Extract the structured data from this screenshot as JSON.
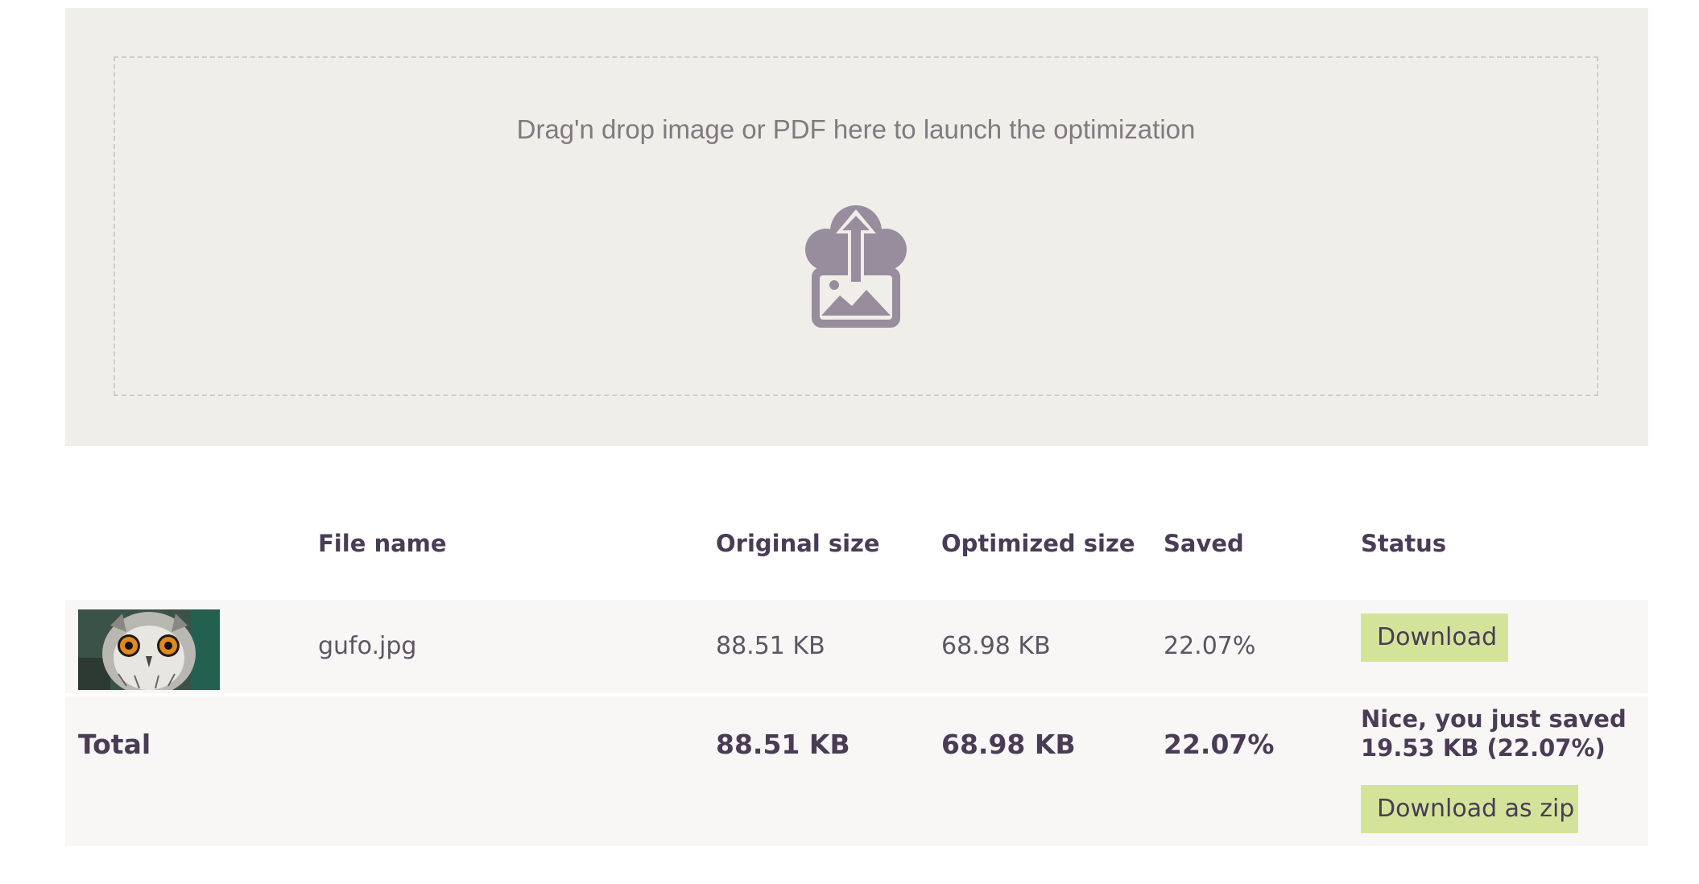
{
  "dropzone": {
    "instruction": "Drag'n drop image or PDF here to launch the optimization",
    "icon": "cloud-upload-image-icon"
  },
  "table": {
    "headers": {
      "thumbnail": "",
      "file_name": "File name",
      "original_size": "Original size",
      "optimized_size": "Optimized size",
      "saved": "Saved",
      "status": "Status"
    },
    "rows": [
      {
        "file_name": "gufo.jpg",
        "original_size": "88.51 KB",
        "optimized_size": "68.98 KB",
        "saved": "22.07%",
        "status_button": "Download"
      }
    ],
    "total": {
      "label": "Total",
      "original_size": "88.51 KB",
      "optimized_size": "68.98 KB",
      "saved": "22.07%",
      "message": "Nice, you just saved 19.53 KB (22.07%)",
      "zip_button": "Download as zip"
    }
  },
  "colors": {
    "dropzone_bg": "#efeee9",
    "button_bg": "#d3e49a",
    "text_primary": "#4a3c55",
    "icon": "#978d9d"
  }
}
